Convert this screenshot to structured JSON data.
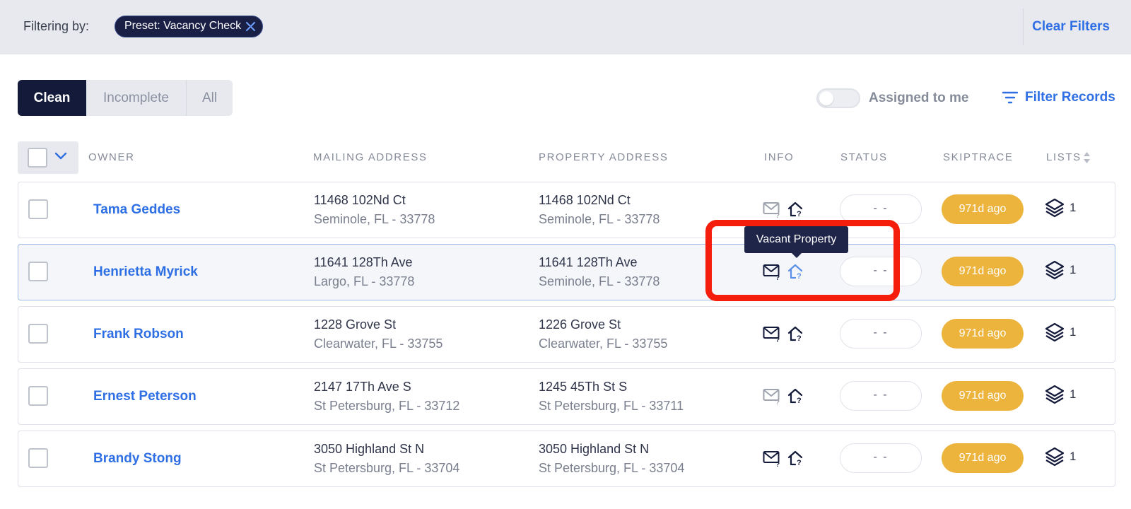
{
  "filter_bar": {
    "label": "Filtering by:",
    "chip_label": "Preset: Vacancy Check",
    "clear_label": "Clear Filters"
  },
  "tabs": [
    {
      "label": "Clean",
      "active": true
    },
    {
      "label": "Incomplete",
      "active": false
    },
    {
      "label": "All",
      "active": false
    }
  ],
  "toolbar": {
    "assigned_label": "Assigned to me",
    "assigned_on": false,
    "filter_records_label": "Filter Records"
  },
  "columns": {
    "owner": "OWNER",
    "mailing": "MAILING ADDRESS",
    "property": "PROPERTY ADDRESS",
    "info": "INFO",
    "status": "STATUS",
    "skiptrace": "SKIPTRACE",
    "lists": "LISTS"
  },
  "rows": [
    {
      "owner": "Tama Geddes",
      "mail_line1": "11468 102Nd Ct",
      "mail_line2": "Seminole, FL - 33778",
      "prop_line1": "11468 102Nd Ct",
      "prop_line2": "Seminole, FL - 33778",
      "mail_icon_state": "inactive",
      "status": "- -",
      "skiptrace": "971d ago",
      "lists": "1"
    },
    {
      "owner": "Henrietta Myrick",
      "mail_line1": "11641 128Th Ave",
      "mail_line2": "Largo, FL - 33778",
      "prop_line1": "11641 128Th Ave",
      "prop_line2": "Seminole, FL - 33778",
      "mail_icon_state": "active",
      "status": "- -",
      "skiptrace": "971d ago",
      "lists": "1"
    },
    {
      "owner": "Frank Robson",
      "mail_line1": "1228 Grove St",
      "mail_line2": "Clearwater, FL - 33755",
      "prop_line1": "1226 Grove St",
      "prop_line2": "Clearwater, FL - 33755",
      "mail_icon_state": "active",
      "status": "- -",
      "skiptrace": "971d ago",
      "lists": "1"
    },
    {
      "owner": "Ernest Peterson",
      "mail_line1": "2147 17Th Ave S",
      "mail_line2": "St Petersburg, FL - 33712",
      "prop_line1": "1245 45Th St S",
      "prop_line2": "St Petersburg, FL - 33711",
      "mail_icon_state": "inactive",
      "status": "- -",
      "skiptrace": "971d ago",
      "lists": "1"
    },
    {
      "owner": "Brandy Stong",
      "mail_line1": "3050 Highland St N",
      "mail_line2": "St Petersburg, FL - 33704",
      "prop_line1": "3050 Highland St N",
      "prop_line2": "St Petersburg, FL - 33704",
      "mail_icon_state": "active",
      "status": "- -",
      "skiptrace": "971d ago",
      "lists": "1"
    }
  ],
  "tooltip": {
    "text": "Vacant Property"
  },
  "colors": {
    "accent_blue": "#2f6fe4",
    "navy": "#131a3a",
    "skiptrace_orange": "#ecb43d",
    "highlight_red": "#f51d0c"
  },
  "icons": [
    "close-icon",
    "filter-icon",
    "chevron-down-icon",
    "sort-icon",
    "mail-question-icon",
    "house-question-icon",
    "layers-icon"
  ]
}
